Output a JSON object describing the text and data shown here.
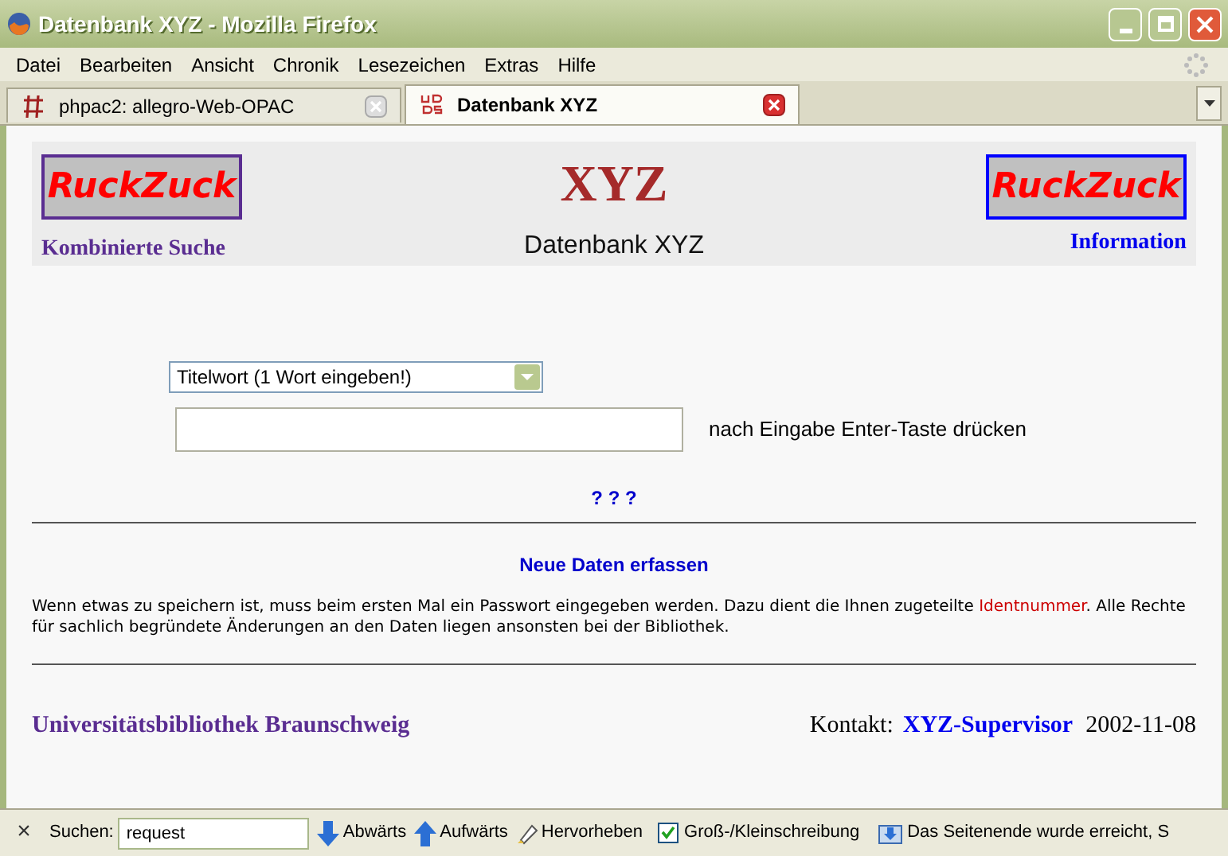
{
  "window": {
    "title": "Datenbank XYZ - Mozilla Firefox"
  },
  "menu": [
    "Datei",
    "Bearbeiten",
    "Ansicht",
    "Chronik",
    "Lesezeichen",
    "Extras",
    "Hilfe"
  ],
  "tabs": [
    {
      "label": "phpac2: allegro-Web-OPAC",
      "selected": false
    },
    {
      "label": "Datenbank XYZ",
      "selected": true
    }
  ],
  "header": {
    "left_logo": "RuckZuck",
    "left_link": "Kombinierte Suche",
    "title": "XYZ",
    "subtitle": "Datenbank XYZ",
    "right_logo": "RuckZuck",
    "right_link": "Information"
  },
  "search": {
    "select_value": "Titelwort (1 Wort eingeben!)",
    "hint": "nach Eingabe Enter-Taste drücken",
    "help_link": "? ? ?"
  },
  "new_data_link": "Neue Daten erfassen",
  "notice": {
    "before": "Wenn etwas zu speichern ist, muss beim ersten Mal ein Passwort eingegeben werden. Dazu dient die Ihnen zugeteilte ",
    "link": "Identnummer",
    "after": ". Alle Rechte für sachlich begründete Änderungen an den Daten liegen ansonsten bei der Bibliothek."
  },
  "footer": {
    "library": "Universitätsbibliothek Braunschweig",
    "contact_label": "Kontakt:",
    "contact_link": "XYZ-Supervisor",
    "date": "2002-11-08"
  },
  "find_bar": {
    "close": "×",
    "label": "Suchen:",
    "value": "request",
    "next": "Abwärts",
    "previous": "Aufwärts",
    "highlight": "Hervorheben",
    "match_case": {
      "label": "Groß-/Kleinschreibung",
      "checked": true
    },
    "status": "Das Seitenende wurde erreicht, S"
  }
}
